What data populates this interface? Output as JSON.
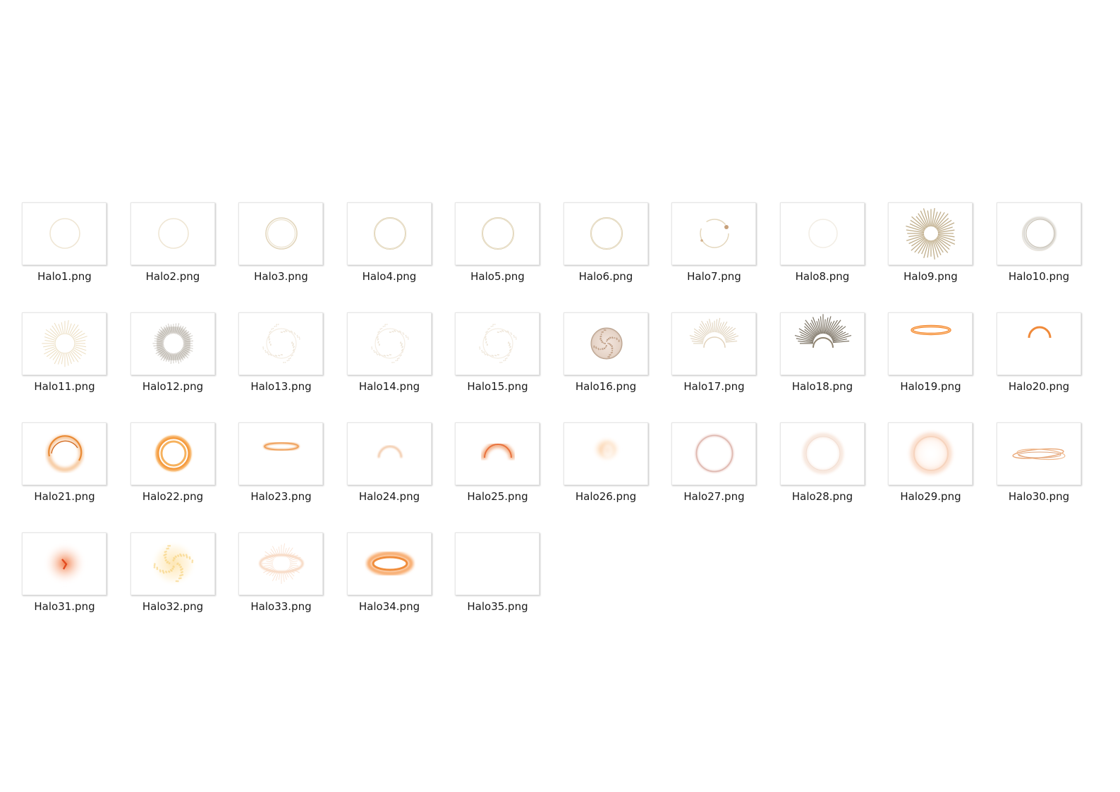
{
  "files": [
    {
      "name": "Halo1.png",
      "icon": "thin-pale-gold-ring"
    },
    {
      "name": "Halo2.png",
      "icon": "thin-pale-gold-ring"
    },
    {
      "name": "Halo3.png",
      "icon": "double-gold-ring"
    },
    {
      "name": "Halo4.png",
      "icon": "gold-ring"
    },
    {
      "name": "Halo5.png",
      "icon": "gold-ring"
    },
    {
      "name": "Halo6.png",
      "icon": "gold-ring"
    },
    {
      "name": "Halo7.png",
      "icon": "broken-gold-ring-with-sparkles"
    },
    {
      "name": "Halo8.png",
      "icon": "faint-gold-ring"
    },
    {
      "name": "Halo9.png",
      "icon": "gold-sunburst"
    },
    {
      "name": "Halo10.png",
      "icon": "sketchy-gold-ring"
    },
    {
      "name": "Halo11.png",
      "icon": "faint-gold-sunburst"
    },
    {
      "name": "Halo12.png",
      "icon": "gray-swirl-ring"
    },
    {
      "name": "Halo13.png",
      "icon": "faint-sparkle-ring"
    },
    {
      "name": "Halo14.png",
      "icon": "faint-sparkle-ring"
    },
    {
      "name": "Halo15.png",
      "icon": "faint-sparkle-ring"
    },
    {
      "name": "Halo16.png",
      "icon": "speckled-gold-disc"
    },
    {
      "name": "Halo17.png",
      "icon": "half-sunburst"
    },
    {
      "name": "Halo18.png",
      "icon": "dark-half-sunburst"
    },
    {
      "name": "Halo19.png",
      "icon": "orange-ellipse-halo"
    },
    {
      "name": "Halo20.png",
      "icon": "orange-arc"
    },
    {
      "name": "Halo21.png",
      "icon": "orange-glow-ring"
    },
    {
      "name": "Halo22.png",
      "icon": "bright-orange-double-ring"
    },
    {
      "name": "Halo23.png",
      "icon": "orange-flat-ellipse"
    },
    {
      "name": "Halo24.png",
      "icon": "faint-orange-arc"
    },
    {
      "name": "Halo25.png",
      "icon": "orange-glow-arc"
    },
    {
      "name": "Halo26.png",
      "icon": "orange-glow-blob"
    },
    {
      "name": "Halo27.png",
      "icon": "soft-pink-ring"
    },
    {
      "name": "Halo28.png",
      "icon": "faint-peach-ring"
    },
    {
      "name": "Halo29.png",
      "icon": "soft-peach-glow-ring"
    },
    {
      "name": "Halo30.png",
      "icon": "intertwined-orange-ellipses"
    },
    {
      "name": "Halo31.png",
      "icon": "orange-burst-glow"
    },
    {
      "name": "Halo32.png",
      "icon": "yellow-sparkle-cloud"
    },
    {
      "name": "Halo33.png",
      "icon": "faint-orange-spiky-ellipse"
    },
    {
      "name": "Halo34.png",
      "icon": "orange-glow-ellipse"
    },
    {
      "name": "Halo35.png",
      "icon": "empty-thumbnail"
    }
  ]
}
